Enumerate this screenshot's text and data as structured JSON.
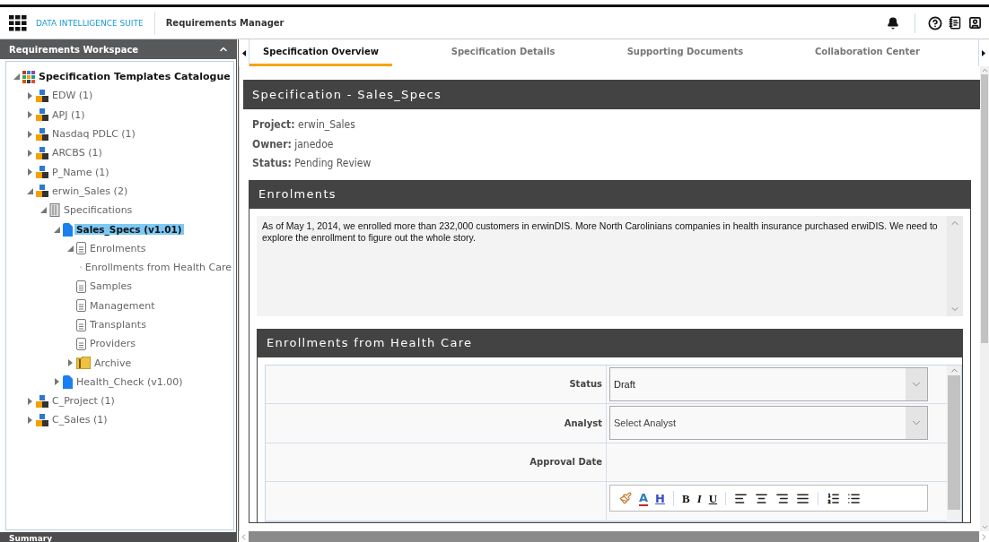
{
  "header": {
    "brand": "DATA INTELLIGENCE SUITE",
    "app_title": "Requirements Manager"
  },
  "workspace": {
    "title": "Requirements Workspace",
    "footer": "Summary",
    "tree": [
      {
        "label": "Specification Templates Catalogue",
        "kind": "catalogue",
        "expanded": true,
        "selected": false,
        "children": [
          {
            "label": "EDW (1)",
            "kind": "project",
            "expanded": false,
            "selected": false
          },
          {
            "label": "APJ (1)",
            "kind": "project",
            "expanded": false,
            "selected": false
          },
          {
            "label": "Nasdaq PDLC (1)",
            "kind": "project",
            "expanded": false,
            "selected": false
          },
          {
            "label": "ARCBS (1)",
            "kind": "project",
            "expanded": false,
            "selected": false
          },
          {
            "label": "P_Name (1)",
            "kind": "project",
            "expanded": false,
            "selected": false
          },
          {
            "label": "erwin_Sales (2)",
            "kind": "project",
            "expanded": true,
            "selected": false,
            "children": [
              {
                "label": "Specifications",
                "kind": "specs",
                "expanded": true,
                "selected": false,
                "children": [
                  {
                    "label": "Sales_Specs (v1.01)",
                    "kind": "spec",
                    "expanded": true,
                    "selected": true,
                    "children": [
                      {
                        "label": "Enrolments",
                        "kind": "doc",
                        "expanded": true,
                        "selected": false,
                        "children": [
                          {
                            "label": "Enrollments from Health Care",
                            "kind": "table",
                            "selected": false
                          }
                        ]
                      },
                      {
                        "label": "Samples",
                        "kind": "doc",
                        "selected": false
                      },
                      {
                        "label": "Management",
                        "kind": "doc",
                        "selected": false
                      },
                      {
                        "label": "Transplants",
                        "kind": "doc",
                        "selected": false
                      },
                      {
                        "label": "Providers",
                        "kind": "doc",
                        "selected": false
                      },
                      {
                        "label": "Archive",
                        "kind": "folder",
                        "expanded": false,
                        "selected": false
                      }
                    ]
                  },
                  {
                    "label": "Health_Check (v1.00)",
                    "kind": "spec",
                    "expanded": false,
                    "selected": false
                  }
                ]
              }
            ]
          },
          {
            "label": "C_Project (1)",
            "kind": "project",
            "expanded": false,
            "selected": false
          },
          {
            "label": "C_Sales (1)",
            "kind": "project",
            "expanded": false,
            "selected": false
          }
        ]
      }
    ]
  },
  "tabs": [
    {
      "label": "Specification Overview",
      "selected": true
    },
    {
      "label": "Specification Details",
      "selected": false
    },
    {
      "label": "Supporting Documents",
      "selected": false
    },
    {
      "label": "Collaboration Center",
      "selected": false
    }
  ],
  "specification": {
    "title": "Specification - Sales_Specs",
    "fields": [
      {
        "label": "Project:",
        "value": "erwin_Sales"
      },
      {
        "label": "Owner:",
        "value": "janedoe"
      },
      {
        "label": "Status:",
        "value": "Pending Review"
      }
    ]
  },
  "enrolments": {
    "title": "Enrolments",
    "text": "As of May 1, 2014, we enrolled more than 232,000 customers in erwinDIS. More North Carolinians companies in health insurance purchased erwiDIS. We need to explore the enrollment to figure out the whole story."
  },
  "health_care": {
    "title": "Enrollments from Health Care",
    "rows": [
      {
        "kind": "select",
        "label": "Status",
        "value": "Draft"
      },
      {
        "kind": "select",
        "label": "Analyst",
        "placeholder": "Select Analyst"
      },
      {
        "kind": "date",
        "label": "Approval Date"
      },
      {
        "kind": "editor"
      }
    ],
    "editor_toolbar": [
      [
        {
          "kind": "paint"
        },
        {
          "kind": "color",
          "label": "A"
        },
        {
          "kind": "highlight",
          "label": "H"
        }
      ],
      [
        {
          "kind": "bold",
          "label": "B"
        },
        {
          "kind": "italic",
          "label": "I"
        },
        {
          "kind": "underline",
          "label": "U"
        }
      ],
      [
        {
          "kind": "align-left"
        },
        {
          "kind": "align-center"
        },
        {
          "kind": "align-right"
        },
        {
          "kind": "justify"
        }
      ],
      [
        {
          "kind": "ordered-list"
        },
        {
          "kind": "bullet-list"
        }
      ]
    ]
  }
}
